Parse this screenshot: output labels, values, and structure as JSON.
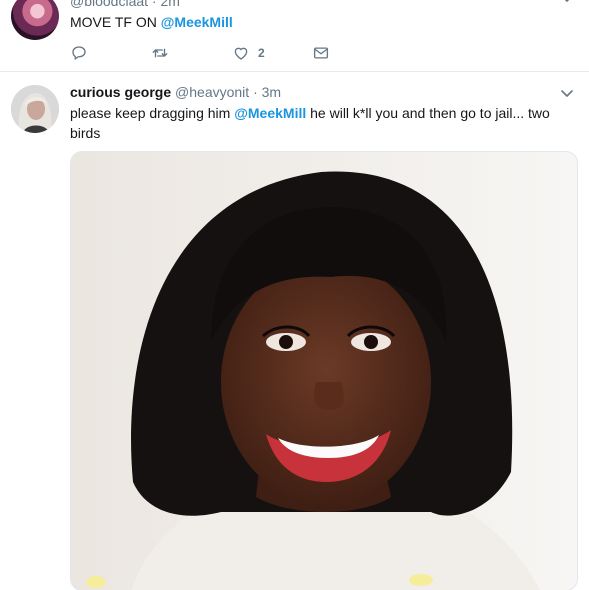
{
  "tweet1": {
    "handle_time": "@bloodclaat · 2m",
    "text_prefix": "MOVE TF ON ",
    "mention": "@MeekMill",
    "actions": {
      "reply_icon": "reply-icon",
      "retweet_icon": "retweet-icon",
      "like_icon": "heart-icon",
      "like_count": "2",
      "dm_icon": "envelope-icon"
    }
  },
  "tweet2": {
    "name": "curious george",
    "handle": "@heavyonit",
    "time": "· 3m",
    "text_prefix": "please keep dragging him ",
    "mention": "@MeekMill",
    "text_suffix": " he will k*ll you and then go to jail... two birds",
    "media_icon": "photo"
  },
  "colors": {
    "mention": "#1b95e0",
    "secondary_text": "#657786",
    "divider": "#e6ecf0"
  }
}
